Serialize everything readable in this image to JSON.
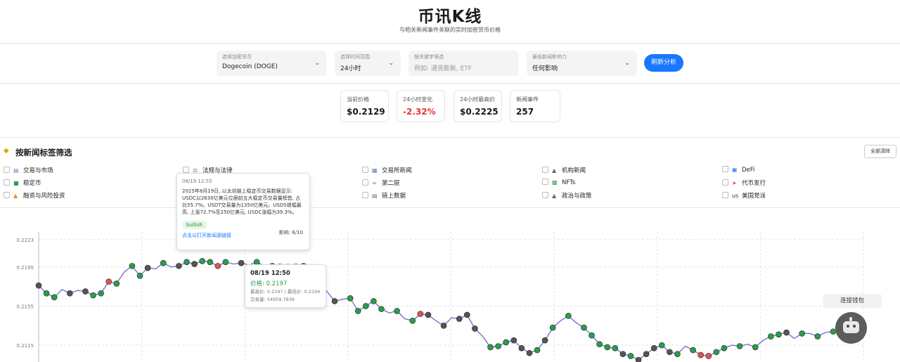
{
  "header": {
    "title": "币讯K线",
    "subtitle": "与相关新闻事件关联的实时加密货币价格"
  },
  "controls": {
    "coin": {
      "label": "选择加密货币",
      "value": "Dogecoin (DOGE)"
    },
    "range": {
      "label": "选择时间范围",
      "value": "24小时"
    },
    "keyword": {
      "label": "按关键字筛选",
      "placeholder": "例如: 通货膨胀, ETF"
    },
    "impact": {
      "label": "最低新闻影响力",
      "value": "任何影响"
    },
    "refresh_label": "刷新分析"
  },
  "stats": [
    {
      "label": "当前价格",
      "value": "$0.2129"
    },
    {
      "label": "24小时变化",
      "value": "-2.32%"
    },
    {
      "label": "24小时最高价",
      "value": "$0.2225"
    },
    {
      "label": "新闻事件",
      "value": "257"
    }
  ],
  "colors": {
    "accent": "#1677ff",
    "negative": "#e53935",
    "positive": "#2a9d4a",
    "line": "#6a6ad8"
  },
  "tags": {
    "title": "按新闻标签筛选",
    "clear_label": "全部清除",
    "items": [
      {
        "label": "交易与市场",
        "icon": "chart-icon"
      },
      {
        "label": "法规与法律",
        "icon": "gavel-icon"
      },
      {
        "label": "交易所新闻",
        "icon": "exchange-icon"
      },
      {
        "label": "机构新闻",
        "icon": "bank-icon"
      },
      {
        "label": "DeFi",
        "icon": "defi-icon"
      },
      {
        "label": "稳定币",
        "icon": "money-icon"
      },
      {
        "label": "第二层",
        "icon": "link-icon"
      },
      {
        "label": "NFTs",
        "icon": "nft-icon"
      },
      {
        "label": "代币发行",
        "icon": "rocket-icon"
      },
      {
        "label": "融资与风险投资",
        "icon": "fire-icon"
      },
      {
        "label": "链上数据",
        "icon": "data-icon"
      },
      {
        "label": "政治与政策",
        "icon": "bank-icon"
      },
      {
        "label": "美国党派",
        "icon": "us-icon",
        "prefix": "us"
      }
    ]
  },
  "news_tooltip": {
    "time": "08/19 12:55",
    "body": "2025年8月19日, 以太坊链上稳定币交易数据显示: USDC以2630亿美元位居前五大稳定币交易量榜首, 占比55.7%。USDT交易量为1350亿美元。USDS增幅最高, 上涨72.7%至250亿美元, USDC涨幅为39.3%。",
    "sentiment": "bullish",
    "impact": "影响: 6/10",
    "link": "点击以打开新闻源链接"
  },
  "price_tooltip": {
    "time": "08/19 12:50",
    "price": "价格: 0.2197",
    "detail1": "最高价: 0.2197 | 最低价: 0.2194",
    "detail2": "交易量: 54959.7836"
  },
  "wallet_label": "连接钱包",
  "chart_data": {
    "type": "line",
    "y_tick_labels": [
      "0.2223",
      "0.2195",
      "0.2155",
      "0.2115"
    ],
    "yticks": [
      0.2223,
      0.2195,
      0.2155,
      0.2115
    ],
    "ylim": [
      0.21,
      0.2225
    ],
    "grid": true,
    "series": [
      {
        "values": [
          0.2176,
          0.2168,
          0.2164,
          0.2172,
          0.2168,
          0.2171,
          0.217,
          0.2166,
          0.2168,
          0.218,
          0.2178,
          0.219,
          0.2196,
          0.2186,
          0.2194,
          0.2193,
          0.2199,
          0.2195,
          0.2196,
          0.22,
          0.2198,
          0.2201,
          0.22,
          0.2196,
          0.22,
          0.2198,
          0.2199,
          0.2197,
          0.22,
          0.2196,
          0.2196,
          0.2198,
          0.2195,
          0.2198,
          0.2196,
          0.2191,
          0.218,
          0.217,
          0.216,
          0.2162,
          0.2163,
          0.215,
          0.2155,
          0.216,
          0.2152,
          0.2148,
          0.215,
          0.2142,
          0.214,
          0.2147,
          0.2146,
          0.214,
          0.2135,
          0.2143,
          0.2142,
          0.2146,
          0.2132,
          0.2124,
          0.2113,
          0.2114,
          0.2118,
          0.212,
          0.2112,
          0.2107,
          0.211,
          0.212,
          0.2133,
          0.214,
          0.2145,
          0.2138,
          0.2133,
          0.2125,
          0.2116,
          0.2113,
          0.2112,
          0.2106,
          0.2104,
          0.21,
          0.2106,
          0.2112,
          0.2115,
          0.2108,
          0.2106,
          0.2114,
          0.211,
          0.2105,
          0.2104,
          0.2108,
          0.2112,
          0.2115,
          0.2114,
          0.2116,
          0.2113,
          0.212,
          0.2124,
          0.2126,
          0.2128,
          0.2122,
          0.2127,
          0.2127,
          0.2124,
          0.2128,
          0.2129
        ]
      }
    ]
  }
}
